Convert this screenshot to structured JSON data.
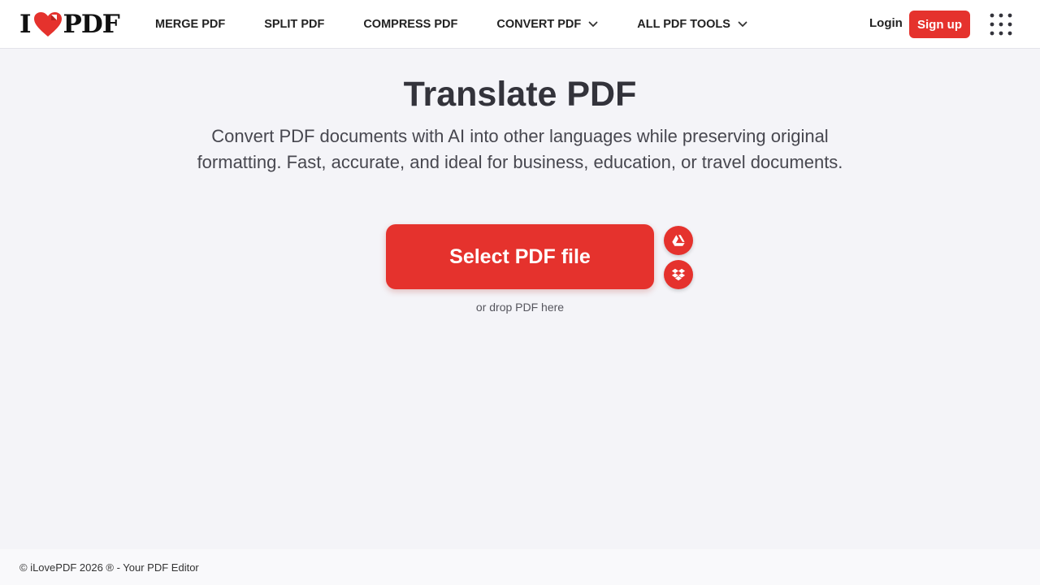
{
  "header": {
    "logo": {
      "left": "I",
      "right": "PDF",
      "icon": "heart-icon"
    },
    "nav": [
      {
        "label": "MERGE PDF",
        "dropdown": false
      },
      {
        "label": "SPLIT PDF",
        "dropdown": false
      },
      {
        "label": "COMPRESS PDF",
        "dropdown": false
      },
      {
        "label": "CONVERT PDF",
        "dropdown": true
      },
      {
        "label": "ALL PDF TOOLS",
        "dropdown": true
      }
    ],
    "login_label": "Login",
    "signup_label": "Sign up",
    "apps_icon": "grid-dots-icon"
  },
  "main": {
    "title": "Translate PDF",
    "subtitle": "Convert PDF documents with AI into other languages while preserving original formatting. Fast, accurate, and ideal for business, education, or travel documents.",
    "select_button_label": "Select PDF file",
    "cloud_sources": [
      {
        "name": "google-drive-icon"
      },
      {
        "name": "dropbox-icon"
      }
    ],
    "drop_hint": "or drop PDF here"
  },
  "footer": {
    "text": "© iLovePDF 2026 ® - Your PDF Editor"
  },
  "colors": {
    "brand": "#e5322d",
    "background": "#f4f4f8",
    "text": "#33333b"
  }
}
